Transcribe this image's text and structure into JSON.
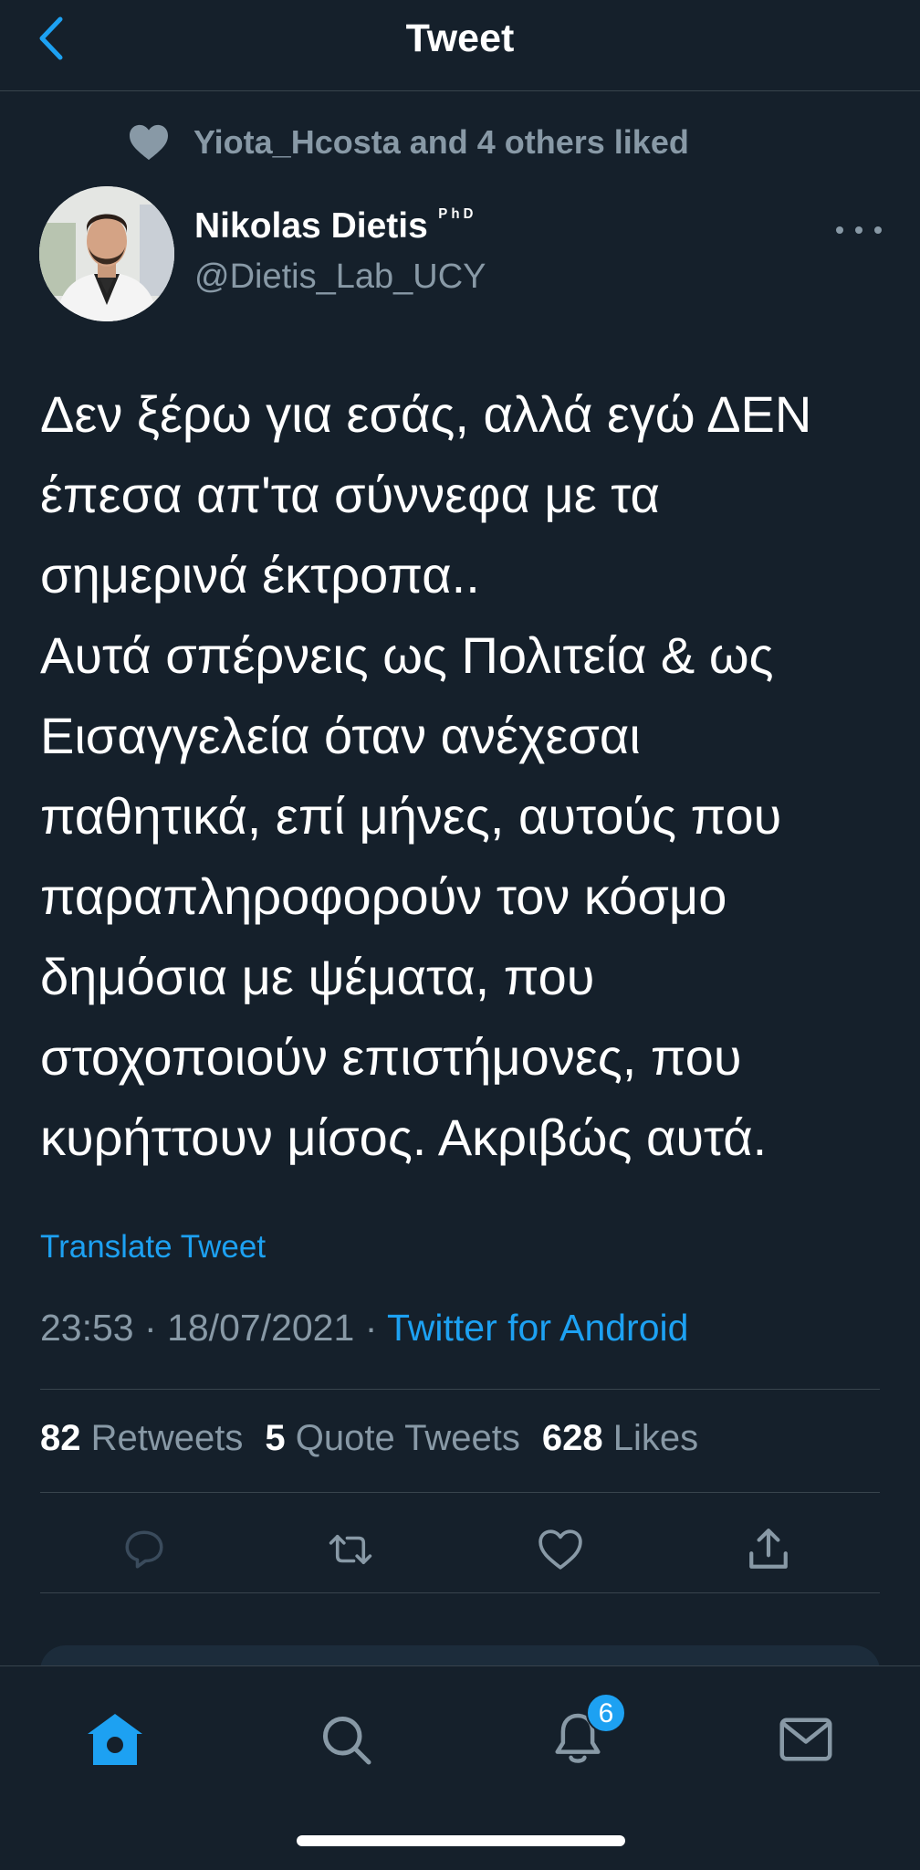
{
  "header": {
    "title": "Tweet"
  },
  "social_context": {
    "text": "Yiota_Hcosta and 4 others liked"
  },
  "author": {
    "name": "Nikolas Dietis",
    "suffix": "ᴾʰᴰ",
    "handle": "@Dietis_Lab_UCY"
  },
  "tweet": {
    "lines": [
      "Δεν ξέρω για εσάς, αλλά εγώ ΔΕΝ",
      "έπεσα απ'τα σύννεφα με τα",
      "σημερινά έκτροπα..",
      "Αυτά σπέρνεις ως Πολιτεία & ως",
      "Εισαγγελεία όταν ανέχεσαι",
      "παθητικά, επί μήνες, αυτούς που",
      "παραπληροφορούν τον κόσμο",
      "δημόσια με ψέματα, που",
      "στοχοποιούν επιστήμονες, που",
      "κυρήττουν μίσος. Ακριβώς αυτά."
    ],
    "translate_label": "Translate Tweet",
    "time": "23:53",
    "date": "18/07/2021",
    "separator": "·",
    "source": "Twitter for Android"
  },
  "stats": {
    "retweets_count": "82",
    "retweets_label": "Retweets",
    "quotes_count": "5",
    "quotes_label": "Quote Tweets",
    "likes_count": "628",
    "likes_label": "Likes"
  },
  "icons": {
    "back": "chevron-left-icon",
    "heart": "heart-icon",
    "more": "more-icon",
    "reply": "reply-icon",
    "retweet": "retweet-icon",
    "like": "heart-icon",
    "share": "share-icon",
    "home": "home-icon",
    "search": "search-icon",
    "notifications": "bell-icon",
    "messages": "mail-icon"
  },
  "tabbar": {
    "notifications_badge": "6"
  },
  "colors": {
    "background": "#15202b",
    "accent": "#1da1f2",
    "secondary": "#8899a6",
    "divider": "#38444d"
  }
}
